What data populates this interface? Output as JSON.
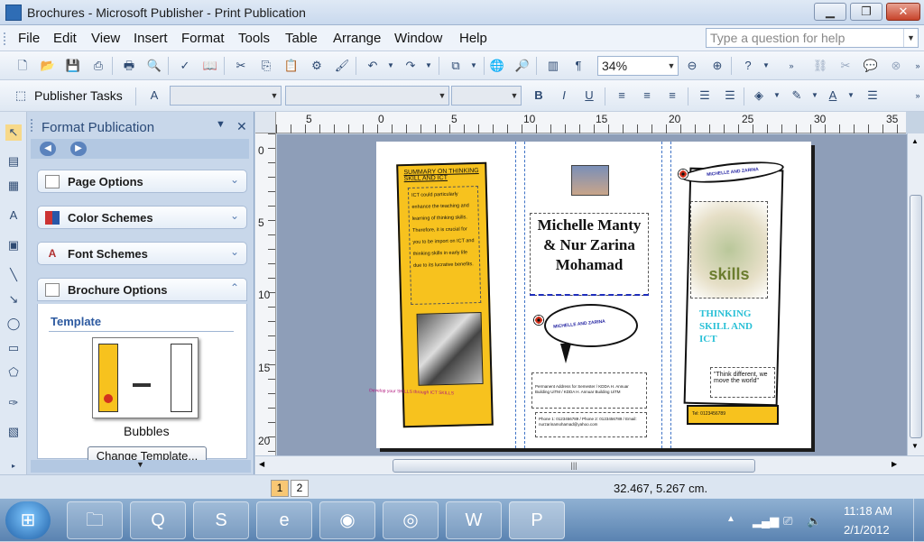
{
  "window": {
    "title": "Brochures - Microsoft Publisher - Print Publication",
    "min_label": "▁",
    "max_label": "❐",
    "close_label": "✕"
  },
  "menu": {
    "items": [
      "File",
      "Edit",
      "View",
      "Insert",
      "Format",
      "Tools",
      "Table",
      "Arrange",
      "Window",
      "Help"
    ],
    "help_placeholder": "Type a question for help"
  },
  "toolbar": {
    "zoom": "34%",
    "publisher_tasks": "Publisher Tasks"
  },
  "task_pane": {
    "title": "Format Publication",
    "sections": [
      {
        "label": "Page Options",
        "icon": "page-icon"
      },
      {
        "label": "Color Schemes",
        "icon": "color-scheme-icon"
      },
      {
        "label": "Font Schemes",
        "icon": "font-scheme-icon"
      },
      {
        "label": "Brochure Options",
        "icon": "brochure-icon"
      }
    ],
    "template_label": "Template",
    "template_name": "Bubbles",
    "change_template": "Change Template..."
  },
  "ruler": {
    "top_ticks": [
      "5",
      "0",
      "5",
      "10",
      "15",
      "20",
      "25",
      "30",
      "35"
    ],
    "left_ticks": [
      "0",
      "5",
      "10",
      "15",
      "20"
    ]
  },
  "brochure": {
    "left_heading": "SUMMARY ON THINKING SKILL AND ICT",
    "left_text": "ICT could particularly enhance the teaching and learning of thinking skills. Therefore, it is crucial for you to be import on ICT and thinking skills in early life due to its lucrative benefits.",
    "left_quote": "Develop your SKILLS through ICT SKILLS",
    "title": "Michelle Manty & Nur Zarina Mohamad",
    "bubble_text": "MICHELLE AND ZARINA",
    "address": "Permanent Address for Semester / KDDA H. Annuar Building UiTM / KDDA H. Annuar Building UiTM",
    "phone": "Phone 1: 0123456789 / Phone 2: 0123456789 / Email: nurzarinamohamad@yahoo.com",
    "banner_text": "MICHELLE AND ZARINA",
    "wordcloud_word": "skills",
    "thinking_text": "THINKING SKILL AND ICT",
    "quote": "\"Think different, we move the world\"",
    "tel": "Tel: 0123456789"
  },
  "status": {
    "pages": [
      "1",
      "2"
    ],
    "coordinates": "32.467, 5.267 cm."
  },
  "taskbar": {
    "apps": [
      "explorer-icon",
      "quicktime-icon",
      "skype-icon",
      "internet-explorer-icon",
      "firefox-icon",
      "chrome-icon",
      "word-icon",
      "publisher-icon"
    ],
    "time": "11:18 AM",
    "date": "2/1/2012"
  }
}
